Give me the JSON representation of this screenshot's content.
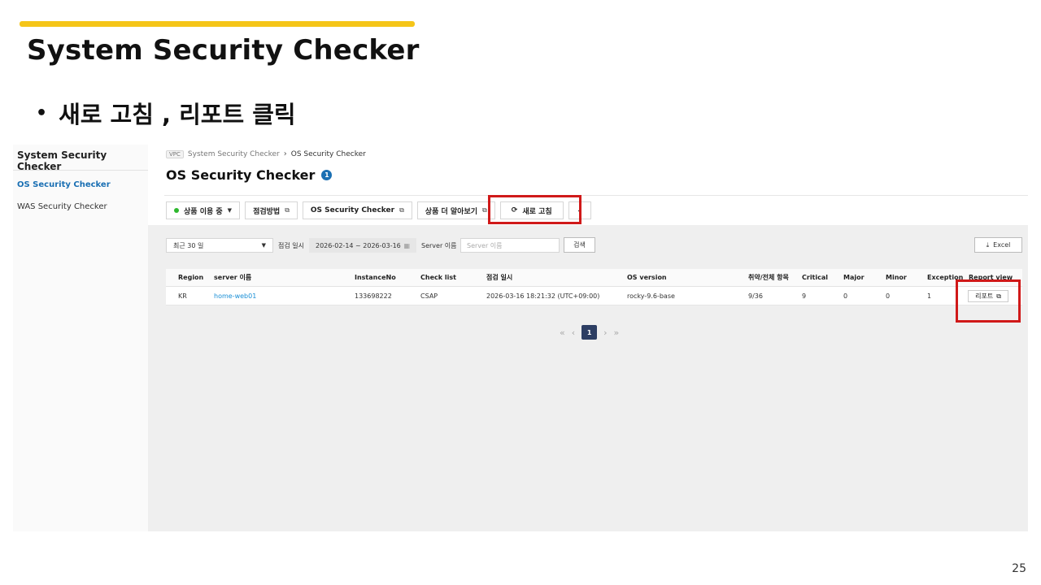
{
  "slide": {
    "title": "System Security Checker",
    "bullet": "새로 고침 , 리포트 클릭",
    "bullet_marker": "•",
    "page_number": "25",
    "accent_color": "#f5c518",
    "highlight_color": "#d01919"
  },
  "sidebar": {
    "title": "System Security Checker",
    "items": [
      {
        "label": "OS Security Checker",
        "active": true
      },
      {
        "label": "WAS Security Checker",
        "active": false
      }
    ]
  },
  "breadcrumb": {
    "badge": "VPC",
    "parent": "System Security Checker",
    "separator": "›",
    "current": "OS Security Checker"
  },
  "header": {
    "title": "OS Security Checker",
    "info_count": "1"
  },
  "toolbar": {
    "status_label": "상품 이용 중",
    "status_caret": "▼",
    "guide_label": "점검방법",
    "os_checker_label": "OS Security Checker",
    "learn_more_label": "상품 더 알아보기",
    "external_icon": "⧉",
    "refresh_icon": "⟳",
    "refresh_label": "새로 고침",
    "more_icon": "⌄"
  },
  "filters": {
    "period_value": "최근 30 일",
    "period_caret": "▼",
    "date_label": "점검 일시",
    "date_range": "2026-02-14 ~ 2026-03-16",
    "calendar_icon": "▦",
    "server_label": "Server 이름",
    "server_placeholder": "Server 이름",
    "search_label": "검색",
    "excel_icon": "⤓",
    "excel_label": "Excel"
  },
  "table": {
    "columns": [
      "Region",
      "server 이름",
      "InstanceNo",
      "Check list",
      "점검 일시",
      "OS version",
      "취약/전체 항목",
      "Critical",
      "Major",
      "Minor",
      "Exception",
      "Report view"
    ],
    "rows": [
      {
        "region": "KR",
        "server": "home-web01",
        "instance": "133698222",
        "checklist": "CSAP",
        "checked_at": "2026-03-16 18:21:32 (UTC+09:00)",
        "os_version": "rocky-9.6-base",
        "vuln_total": "9/36",
        "critical": "9",
        "major": "0",
        "minor": "0",
        "exception": "1",
        "report_label": "리포트",
        "report_icon": "⧉"
      }
    ]
  },
  "pagination": {
    "first": "«",
    "prev": "‹",
    "current": "1",
    "next": "›",
    "last": "»"
  }
}
